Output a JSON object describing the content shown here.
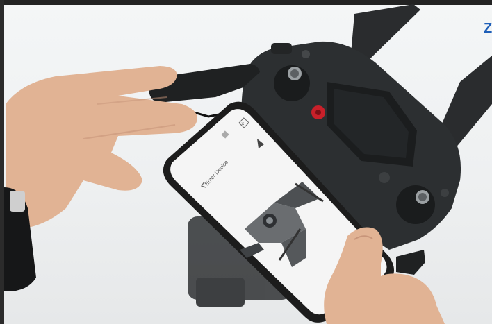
{
  "scene": {
    "description_tag": "photo",
    "watermark_text": "Z",
    "phone_screen": {
      "back_label": "Enter Device",
      "close_symbol": "×"
    }
  },
  "colors": {
    "background": "#f1f3f4",
    "controller": "#2c2f31",
    "skin": "#e3b89c",
    "phone_frame": "#1c1c1c",
    "phone_screen": "#f5f5f5",
    "power_button": "#c8202a",
    "watermark": "#1f5fb8"
  },
  "icons": [
    "arrow-back-icon",
    "close-icon",
    "drone-icon",
    "menu-icon"
  ]
}
